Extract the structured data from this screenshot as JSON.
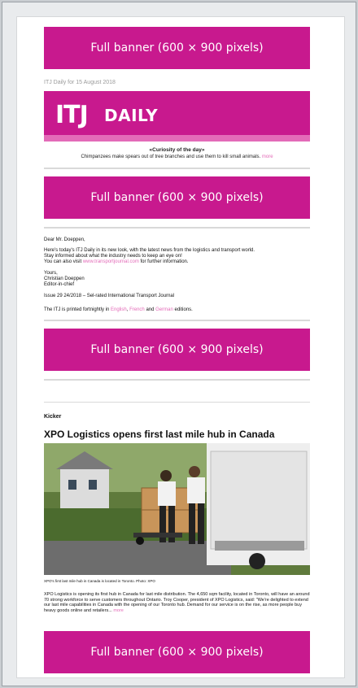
{
  "banners": [
    "Full banner (600 × 900 pixels)",
    "Full banner (600 × 900 pixels)",
    "Full banner (600 × 900 pixels)",
    "Full banner (600 × 900 pixels)"
  ],
  "newsletter": {
    "date_line": "ITJ Daily for 15 August 2018",
    "logo_itj": "ITJ",
    "logo_daily": "DAILY",
    "curiosity_title": "«Curiosity of the day»",
    "curiosity_text": "Chimpanzees make spears out of tree branches and use them to kill small animals.",
    "curiosity_more": "more"
  },
  "letter": {
    "greeting": "Dear Mr. Doeppen,",
    "line1": "Here's today's ITJ Daily in its new look, with the latest news from the logistics and transport world.",
    "line2": "Stay informed about what the industry needs to keep an eye on!",
    "line3_prefix": "You can also visit",
    "line3_link": "www.transportjournal.com",
    "line3_suffix": "for further information.",
    "closing": "Yours,",
    "name": "Christian Doeppen",
    "role": "Editor-in-chief",
    "issue_link": "Issue 29 24/2018 – Sel-rated International Transport Journal",
    "editions_prefix": "The ITJ is printed fortnightly in",
    "edition_en": "English",
    "edition_sep": ",",
    "edition_fr": "French",
    "edition_and": "and",
    "edition_de": "German",
    "editions_suffix": "editions."
  },
  "article": {
    "kicker": "Kicker",
    "headline": "XPO Logistics opens first last mile hub in Canada",
    "caption": "XPO's first last mile hub in Canada is located in Toronto. Photo: XPO",
    "body": "XPO Logistics is opening its first hub in Canada for last mile distribution. The 4,650 sqm facility, located in Toronto, will have an around 70 strong workforce to serve customers throughout Ontario. Troy Cooper, president of XPO Logistics, said: \"We're delighted to extend our last mile capabilities in Canada with the opening of our Toronto hub. Demand for our service is on the rise, as more people buy heavy goods online and retailers...",
    "more": "more"
  },
  "colors": {
    "banner": "#c8198e",
    "link": "#e36bb8",
    "page_bg": "#e9ebed"
  }
}
